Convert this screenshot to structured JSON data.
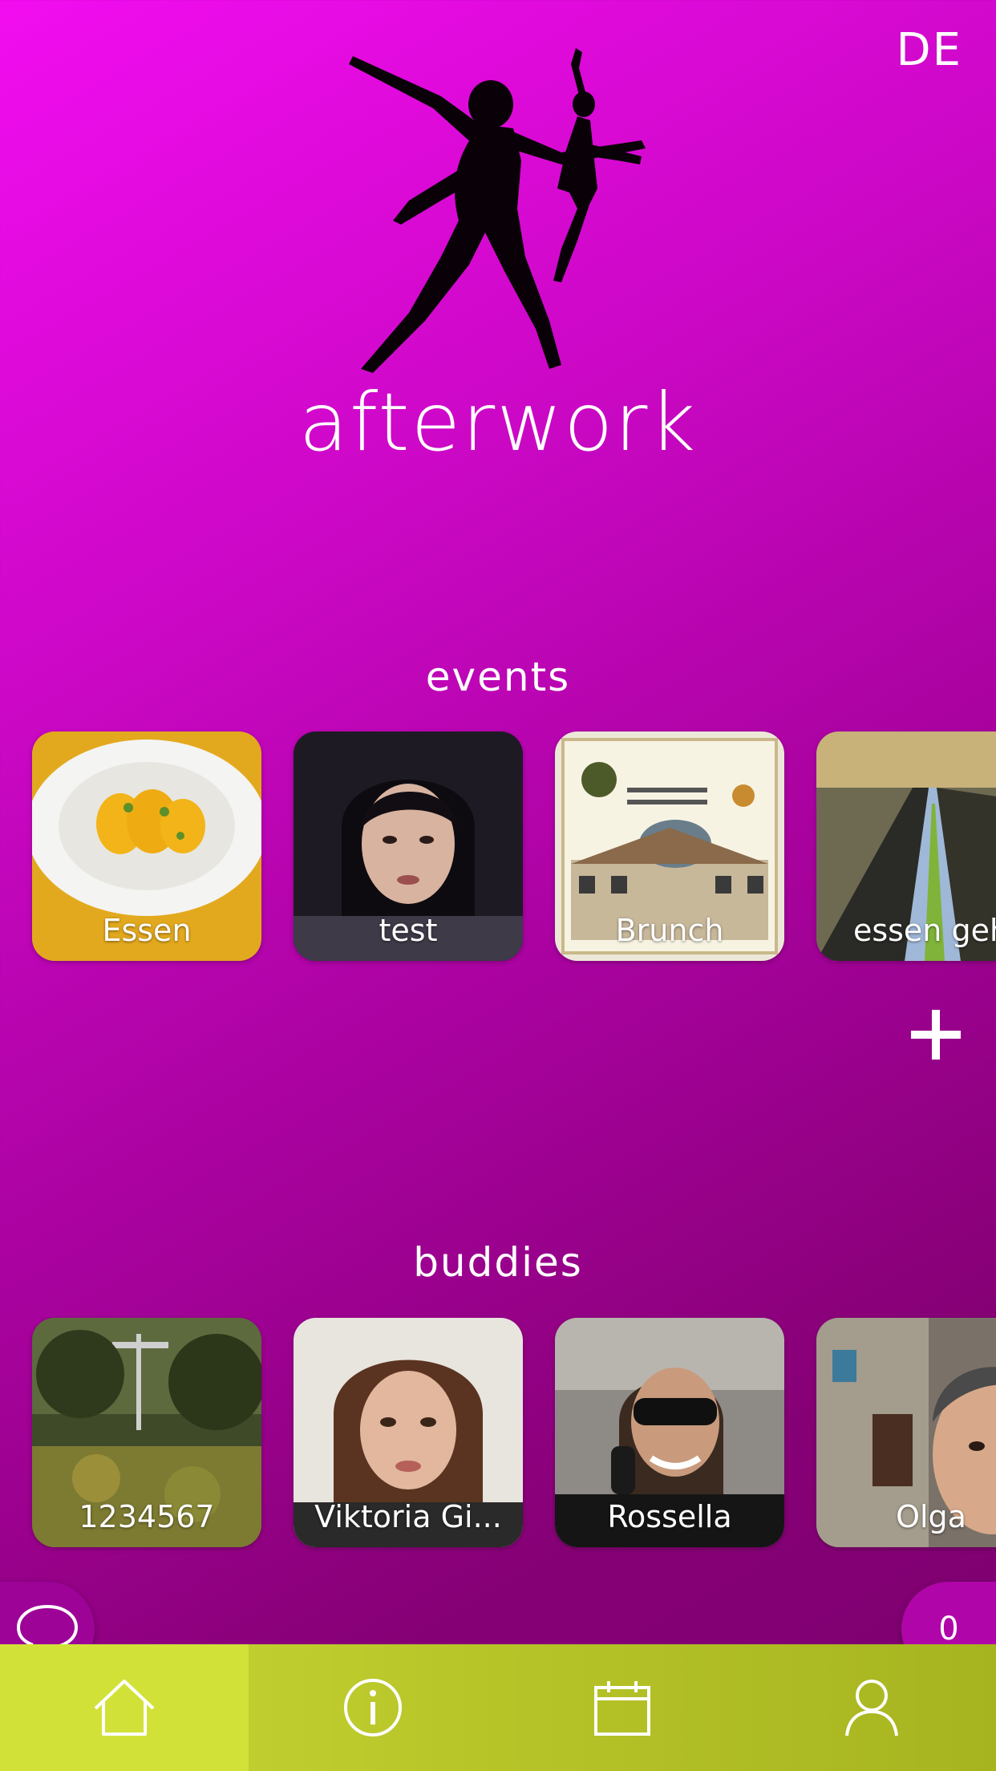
{
  "header": {
    "language": "DE",
    "brand": "afterwork"
  },
  "events": {
    "title": "events",
    "items": [
      {
        "label": "Essen"
      },
      {
        "label": "test"
      },
      {
        "label": "Brunch"
      },
      {
        "label": "essen geh"
      }
    ]
  },
  "buddies": {
    "title": "buddies",
    "items": [
      {
        "label": "1234567"
      },
      {
        "label": "Viktoria Gi..."
      },
      {
        "label": "Rossella"
      },
      {
        "label": "Olga"
      }
    ]
  },
  "floating": {
    "counter": "0"
  },
  "tabbar": {
    "items": [
      {
        "icon": "home-icon",
        "active": true
      },
      {
        "icon": "info-icon",
        "active": false
      },
      {
        "icon": "calendar-icon",
        "active": false
      },
      {
        "icon": "profile-icon",
        "active": false
      }
    ]
  },
  "colors": {
    "background_start": "#f20df0",
    "background_end": "#7c0070",
    "tabbar": "#b7c428",
    "tabbar_active": "#d2e138"
  }
}
